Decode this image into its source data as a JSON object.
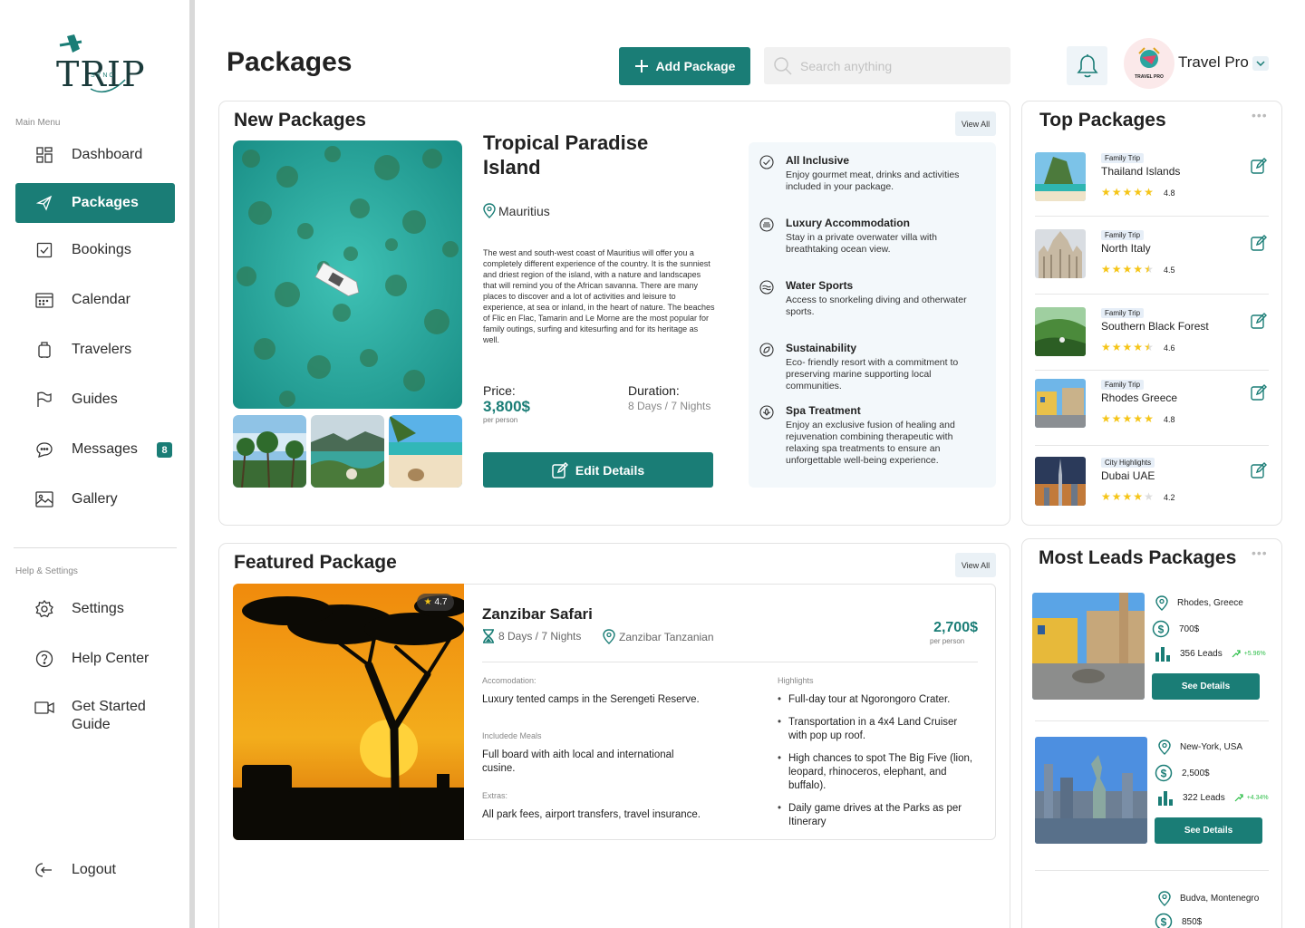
{
  "brand": {
    "logo_text": "TRIP",
    "logo_sub": "SYNC"
  },
  "sidebar": {
    "main_caption": "Main Menu",
    "help_caption": "Help & Settings",
    "items": [
      {
        "label": "Dashboard"
      },
      {
        "label": "Packages"
      },
      {
        "label": "Bookings"
      },
      {
        "label": "Calendar"
      },
      {
        "label": "Travelers"
      },
      {
        "label": "Guides"
      },
      {
        "label": "Messages",
        "badge": "8"
      },
      {
        "label": "Gallery"
      }
    ],
    "help_items": [
      {
        "label": "Settings"
      },
      {
        "label": "Help Center"
      },
      {
        "label": "Get Started Guide"
      }
    ],
    "logout": "Logout"
  },
  "header": {
    "title": "Packages",
    "add_label": "Add Package",
    "search_placeholder": "Search anything",
    "profile_name": "Travel Pro",
    "profile_logo_text": "TRAVEL PRO"
  },
  "new_packages": {
    "title": "New Packages",
    "view_all": "View All",
    "name": "Tropical Paradise Island",
    "location": "Mauritius",
    "description": "The west and south-west coast of Mauritius will offer you a completely different experience of the country. It is the sunniest and driest region of the island, with a nature and landscapes that will remind you of the African savanna. There are many places to discover and a lot of activities and leisure to experience, at sea or inland, in the heart of nature. The beaches of Flic en Flac, Tamarin and Le Morne are the most popular for family outings, surfing and kitesurfing and for its heritage as well.",
    "price_label": "Price:",
    "price": "3,800$",
    "per_person": "per person",
    "duration_label": "Duration:",
    "duration": "8 Days / 7 Nights",
    "edit_label": "Edit Details",
    "features": [
      {
        "icon": "check-circle-icon",
        "title": "All Inclusive",
        "desc": "Enjoy gourmet meat, drinks and activities included in your package."
      },
      {
        "icon": "bed-icon",
        "title": "Luxury Accommodation",
        "desc": "Stay in a private overwater villa with breathtaking ocean view."
      },
      {
        "icon": "wave-icon",
        "title": "Water Sports",
        "desc": "Access to snorkeling diving and otherwater sports."
      },
      {
        "icon": "leaf-icon",
        "title": "Sustainability",
        "desc": "Eco- friendly resort with a commitment to preserving marine supporting local communities."
      },
      {
        "icon": "lotus-icon",
        "title": "Spa Treatment",
        "desc": "Enjoy an exclusive fusion of healing and rejuvenation combining therapeutic with relaxing spa treatments to ensure an unforgettable well-being experience."
      }
    ]
  },
  "featured": {
    "title": "Featured Package",
    "view_all": "View All",
    "rating": "4.7",
    "name": "Zanzibar Safari",
    "duration": "8 Days / 7 Nights",
    "location": "Zanzibar Tanzanian",
    "price": "2,700$",
    "per_person": "per person",
    "accommodation_label": "Accomodation:",
    "accommodation": "Luxury tented camps in the Serengeti Reserve.",
    "meals_label": "Includede Meals",
    "meals": "Full board with aith local and international cusine.",
    "extras_label": "Extras:",
    "extras": "All park fees, airport transfers, travel insurance.",
    "highlights_label": "Highlights",
    "highlights": [
      "Full-day tour at Ngorongoro Crater.",
      "Transportation in a 4x4 Land Cruiser with pop up roof.",
      "High chances to spot The Big Five (lion, leopard, rhinoceros, elephant, and buffalo).",
      "Daily game drives at the Parks as per Itinerary"
    ]
  },
  "top_packages": {
    "title": "Top Packages",
    "items": [
      {
        "tag": "Family Trip",
        "name": "Thailand Islands",
        "rating": "4.8",
        "stars": 5
      },
      {
        "tag": "Family Trip",
        "name": "North Italy",
        "rating": "4.5",
        "stars": 4.5
      },
      {
        "tag": "Family Trip",
        "name": "Southern Black Forest",
        "rating": "4.6",
        "stars": 4.5
      },
      {
        "tag": "Family Trip",
        "name": "Rhodes Greece",
        "rating": "4.8",
        "stars": 5
      },
      {
        "tag": "City Highlights",
        "name": "Dubai UAE",
        "rating": "4.2",
        "stars": 4
      }
    ]
  },
  "most_leads": {
    "title": "Most Leads Packages",
    "button": "See Details",
    "items": [
      {
        "location": "Rhodes, Greece",
        "price": "700$",
        "leads": "356 Leads",
        "growth": "+5.96%"
      },
      {
        "location": "New-York, USA",
        "price": "2,500$",
        "leads": "322 Leads",
        "growth": "+4.34%"
      },
      {
        "location": "Budva, Montenegro",
        "price": "850$"
      }
    ]
  },
  "colors": {
    "accent": "#1a7d76",
    "star": "#f5c518",
    "growth": "#2fbf4a"
  }
}
